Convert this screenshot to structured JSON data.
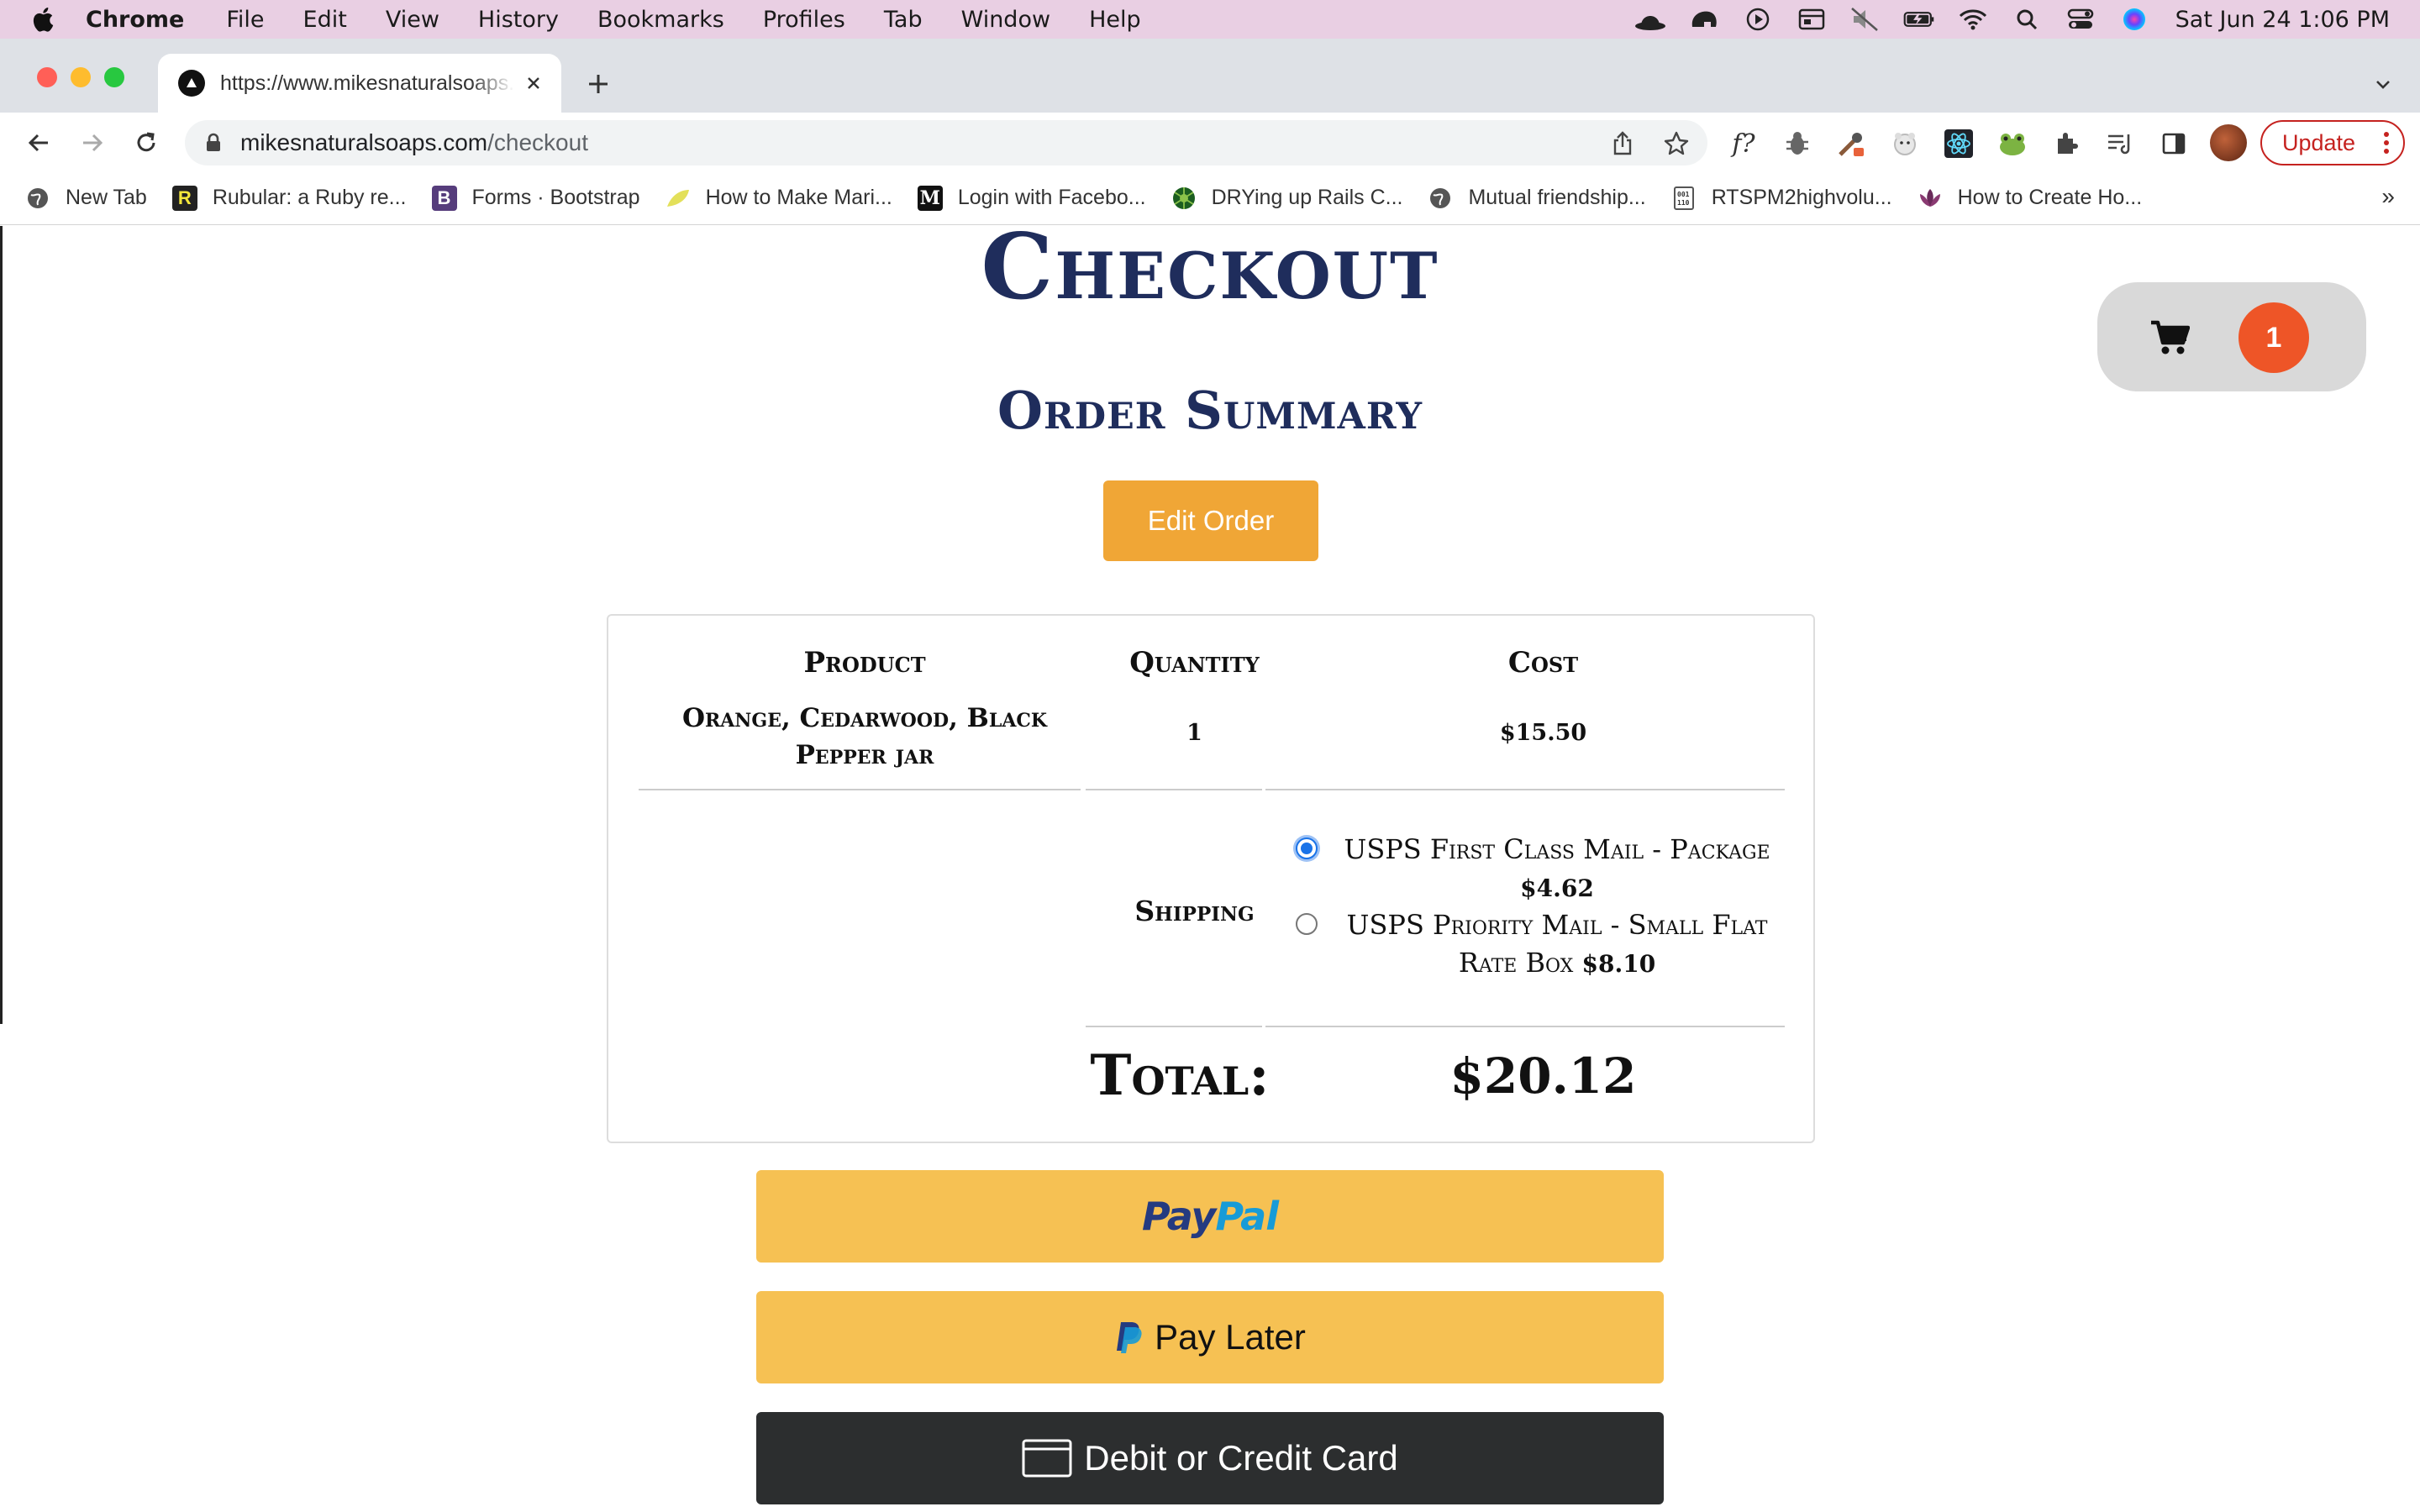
{
  "menubar": {
    "app": "Chrome",
    "items": [
      "File",
      "Edit",
      "View",
      "History",
      "Bookmarks",
      "Profiles",
      "Tab",
      "Window",
      "Help"
    ],
    "clock": "Sat Jun 24  1:06 PM"
  },
  "browser": {
    "tab_title": "https://www.mikesnaturalsoaps.com/checkout",
    "url_host": "mikesnaturalsoaps.com",
    "url_path": "/checkout",
    "update_label": "Update",
    "bookmarks": [
      "New Tab",
      "Rubular: a Ruby re...",
      "Forms · Bootstrap",
      "How to Make Mari...",
      "Login with Facebo...",
      "DRYing up Rails C...",
      "Mutual friendship...",
      "RTSPM2highvolu...",
      "How to Create Ho..."
    ],
    "bookmarks_more": "»"
  },
  "page": {
    "title": "Checkout",
    "summary_title": "Order Summary",
    "edit_order_label": "Edit Order",
    "cart_count": "1",
    "table": {
      "headers": {
        "product": "Product",
        "quantity": "Quantity",
        "cost": "Cost"
      },
      "items": [
        {
          "product": "Orange, Cedarwood, Black Pepper jar",
          "quantity": "1",
          "cost": "$15.50"
        }
      ],
      "shipping_label": "Shipping",
      "shipping_options": [
        {
          "name": "USPS First Class Mail - Package",
          "price": "$4.62",
          "selected": true
        },
        {
          "name": "USPS Priority Mail - Small Flat Rate Box",
          "price": "$8.10",
          "selected": false
        }
      ],
      "total_label": "Total:",
      "total_value": "$20.12"
    },
    "payment": {
      "paypal_part1": "Pay",
      "paypal_part2": "Pal",
      "pay_later_label": "Pay Later",
      "card_label": "Debit or Credit Card"
    }
  },
  "colors": {
    "menubar_bg": "#e9cfe3",
    "heading": "#1f2d5c",
    "edit_button": "#f0a636",
    "cart_badge": "#ee5527",
    "paypal_yellow": "#f6c153",
    "card_dark": "#2c2e2f"
  },
  "icons": [
    "apple-icon",
    "search-icon",
    "wifi-icon",
    "battery-icon",
    "cart-icon",
    "lock-icon",
    "back-icon",
    "forward-icon",
    "reload-icon",
    "share-icon",
    "star-icon",
    "extensions-icon",
    "card-icon"
  ]
}
